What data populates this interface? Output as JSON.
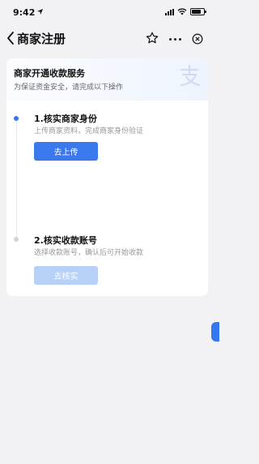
{
  "status_bar": {
    "time": "9:42",
    "battery_level": 0.8
  },
  "nav": {
    "title": "商家注册"
  },
  "card": {
    "title": "商家开通收款服务",
    "subtitle": "为保证资金安全，请完成以下操作",
    "steps": [
      {
        "title": "1.核实商家身份",
        "desc": "上传商家资料，完成商家身份验证",
        "button": "去上传",
        "state": "active"
      },
      {
        "title": "2.核实收款账号",
        "desc": "选择收款账号，确认后可开始收款",
        "button": "去核实",
        "state": "disabled"
      }
    ]
  },
  "colors": {
    "accent": "#3a78ee",
    "disabled": "#b7d0f7",
    "background": "#f2f2f4"
  }
}
